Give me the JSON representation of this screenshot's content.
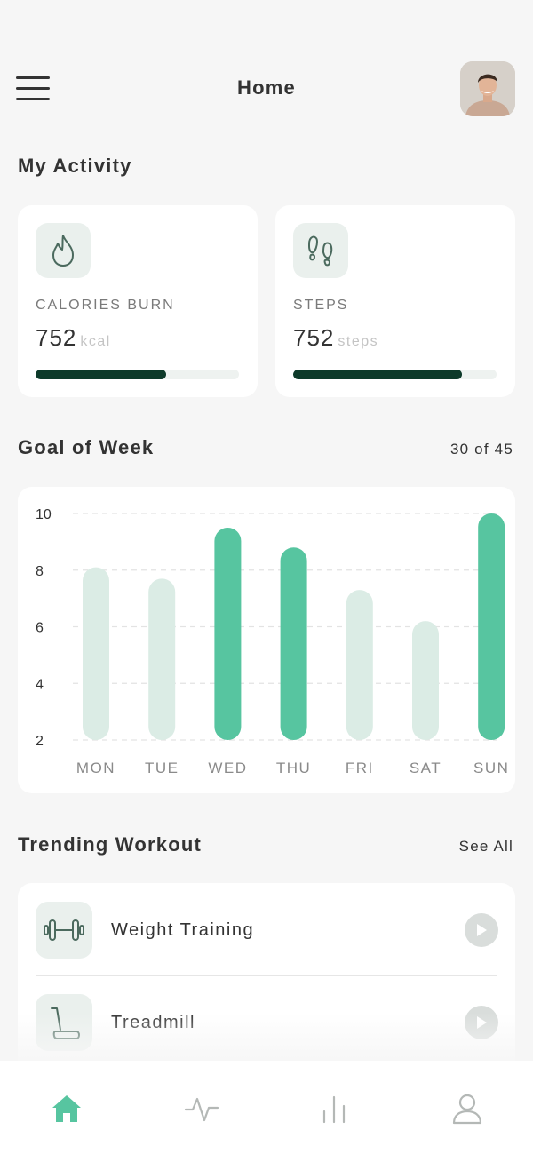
{
  "header": {
    "title": "Home"
  },
  "activity": {
    "title": "My Activity",
    "cards": [
      {
        "label": "CALORIES BURN",
        "value": "752",
        "unit": "kcal",
        "progress": 0.64,
        "icon": "flame-icon"
      },
      {
        "label": "STEPS",
        "value": "752",
        "unit": "steps",
        "progress": 0.83,
        "icon": "footprints-icon"
      }
    ]
  },
  "goal": {
    "title": "Goal of Week",
    "progress_text": "30 of 45"
  },
  "chart_data": {
    "type": "bar",
    "categories": [
      "MON",
      "TUE",
      "WED",
      "THU",
      "FRI",
      "SAT",
      "SUN"
    ],
    "values": [
      8.1,
      7.7,
      9.5,
      8.8,
      7.3,
      6.2,
      10
    ],
    "highlighted": [
      false,
      false,
      true,
      true,
      false,
      false,
      true
    ],
    "y_ticks": [
      "10",
      "8",
      "6",
      "4",
      "2"
    ],
    "ylim": [
      2,
      10
    ],
    "grid": true,
    "colors": {
      "highlight": "#57c5a0",
      "normal": "#dbece5"
    }
  },
  "trending": {
    "title": "Trending Workout",
    "see_all": "See All",
    "items": [
      {
        "label": "Weight Training",
        "icon": "dumbbell-icon"
      },
      {
        "label": "Treadmill",
        "icon": "treadmill-icon"
      }
    ]
  },
  "tabs": [
    {
      "name": "home",
      "icon": "home-icon",
      "active": true
    },
    {
      "name": "activity",
      "icon": "activity-icon",
      "active": false
    },
    {
      "name": "stats",
      "icon": "bar-chart-icon",
      "active": false
    },
    {
      "name": "profile",
      "icon": "user-icon",
      "active": false
    }
  ],
  "colors": {
    "accent": "#57c5a0",
    "dark": "#0d3a2a"
  }
}
